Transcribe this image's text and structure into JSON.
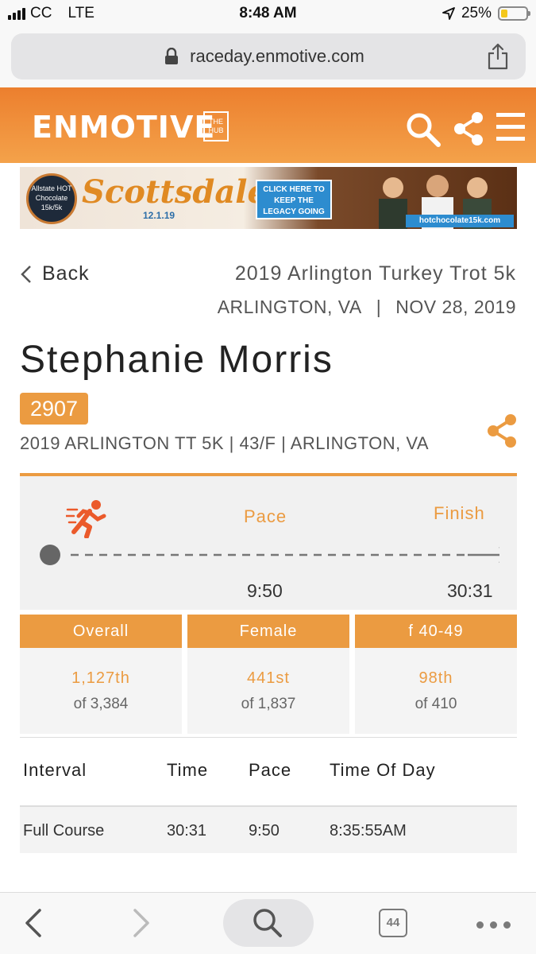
{
  "status_bar": {
    "carrier": "CC",
    "network": "LTE",
    "time": "8:48 AM",
    "battery": "25%",
    "battery_level": 0.25
  },
  "browser": {
    "url": "raceday.enmotive.com"
  },
  "header": {
    "logo": "ENMOTIVE",
    "logo_hub": "THE HUB"
  },
  "ad": {
    "badge": "Allstate HOT Chocolate 15k/5k",
    "city": "Scottsdale",
    "date": "12.1.19",
    "cta": "CLICK HERE TO KEEP THE LEGACY GOING",
    "site": "hotchocolate15k.com"
  },
  "race": {
    "back_label": "Back",
    "name": "2019 Arlington Turkey Trot 5k",
    "location": "ARLINGTON, VA",
    "separator": "|",
    "date": "NOV 28, 2019"
  },
  "athlete": {
    "name": "Stephanie Morris",
    "bib": "2907",
    "meta": "2019 ARLINGTON TT 5K | 43/F | ARLINGTON, VA"
  },
  "progress": {
    "pace_label": "Pace",
    "finish_label": "Finish",
    "pace_value": "9:50",
    "finish_value": "30:31"
  },
  "ranks": [
    {
      "label": "Overall",
      "place": "1,127th",
      "of": "of 3,384"
    },
    {
      "label": "Female",
      "place": "441st",
      "of": "of 1,837"
    },
    {
      "label": "f 40-49",
      "place": "98th",
      "of": "of 410"
    }
  ],
  "splits": {
    "columns": [
      "Interval",
      "Time",
      "Pace",
      "Time Of Day"
    ],
    "rows": [
      {
        "interval": "Full Course",
        "time": "30:31",
        "pace": "9:50",
        "time_of_day": "8:35:55AM"
      }
    ]
  },
  "toolbar": {
    "tabs_count": "44"
  },
  "colors": {
    "accent": "#eb9b41",
    "header_orange": "#ec7f2e"
  }
}
